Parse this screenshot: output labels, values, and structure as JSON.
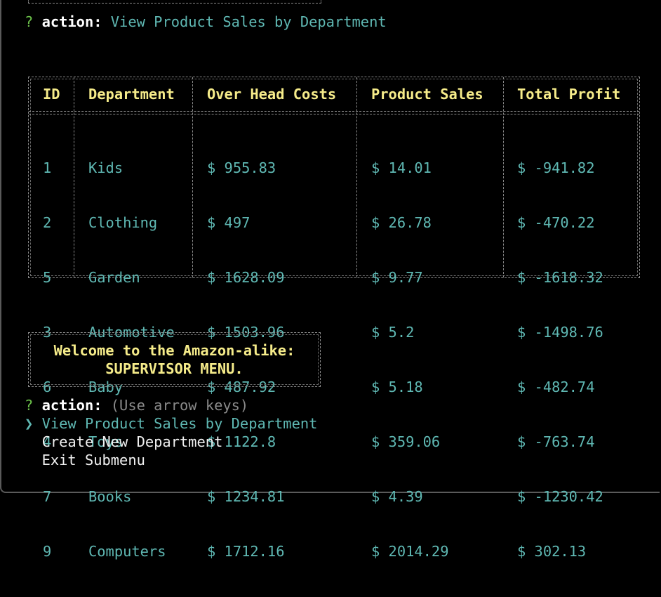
{
  "prompt1": {
    "mark": "?",
    "label": "action:",
    "answer": "View Product Sales by Department"
  },
  "table": {
    "headers": [
      "ID",
      "Department",
      "Over Head Costs",
      "Product Sales",
      "Total Profit"
    ],
    "rows": [
      [
        "1",
        "Kids",
        "$ 955.83",
        "$ 14.01",
        "$ -941.82"
      ],
      [
        "2",
        "Clothing",
        "$ 497",
        "$ 26.78",
        "$ -470.22"
      ],
      [
        "5",
        "Garden",
        "$ 1628.09",
        "$ 9.77",
        "$ -1618.32"
      ],
      [
        "3",
        "Automotive",
        "$ 1503.96",
        "$ 5.2",
        "$ -1498.76"
      ],
      [
        "6",
        "Baby",
        "$ 487.92",
        "$ 5.18",
        "$ -482.74"
      ],
      [
        "4",
        "Toys",
        "$ 1122.8",
        "$ 359.06",
        "$ -763.74"
      ],
      [
        "7",
        "Books",
        "$ 1234.81",
        "$ 4.39",
        "$ -1230.42"
      ],
      [
        "9",
        "Computers",
        "$ 1712.16",
        "$ 2014.29",
        "$ 302.13"
      ]
    ]
  },
  "banner": {
    "line1": "Welcome to the Amazon-alike:",
    "line2": "SUPERVISOR MENU."
  },
  "prompt2": {
    "mark": "?",
    "label": "action:",
    "hint": "(Use arrow keys)",
    "pointer": "❯",
    "options": [
      "View Product Sales by Department",
      "Create New Department",
      "Exit Submenu"
    ],
    "selected_index": 0
  },
  "colors": {
    "question_mark": "#6cc24a",
    "answer": "#5fb8b3",
    "header": "#f6ec8a",
    "hint": "#8a8a8a",
    "background": "#000000"
  }
}
